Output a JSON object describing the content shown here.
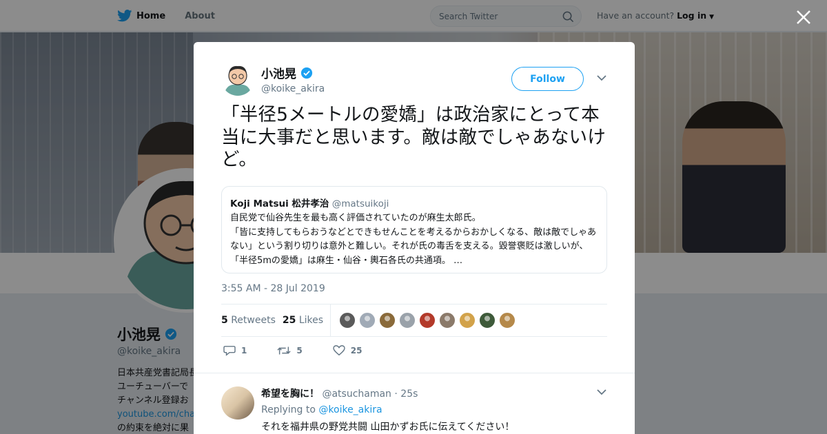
{
  "nav": {
    "home_label": "Home",
    "about_label": "About",
    "search_placeholder": "Search Twitter",
    "account_prompt": "Have an account?",
    "login_label": "Log in"
  },
  "profile": {
    "name": "小池晃",
    "handle": "@koike_akira",
    "bio_lines": [
      "日本共産党書記局長",
      "ユーチューバーで",
      "チャンネル登録お",
      "youtube.com/channel",
      "の約束を絶対に果"
    ]
  },
  "tweet": {
    "author_name": "小池晃",
    "author_handle": "@koike_akira",
    "follow_label": "Follow",
    "text": "「半径5メートルの愛嬌」は政治家にとって本当に大事だと思います。敵は敵でしゃあないけど。",
    "quote": {
      "name": "Koji Matsui 松井孝治",
      "handle": "@matsuikoji",
      "text": "自民党で仙谷先生を最も高く評価されていたのが麻生太郎氏。\n「皆に支持してもらおうなどとできもせんことを考えるからおかしくなる、敵は敵でしゃあない」という割り切りは意外と難しい。それが氏の毒舌を支える。毀誉褒貶は激しいが、「半径5mの愛嬌」は麻生・仙谷・輿石各氏の共通項。 …"
    },
    "timestamp": "3:55 AM - 28 Jul 2019",
    "retweets_count": "5",
    "retweets_label": "Retweets",
    "likes_count": "25",
    "likes_label": "Likes",
    "actions": {
      "reply_count": "1",
      "retweet_count": "5",
      "like_count": "25"
    },
    "likers_colors": [
      "#5a5a5a",
      "#a0aab6",
      "#8a6a3a",
      "#9aa2aa",
      "#b33a2a",
      "#8b7a6a",
      "#d2a24a",
      "#3e5a3a",
      "#b5894a"
    ]
  },
  "reply": {
    "name": "希望を胸に！",
    "handle": "@atsuchaman",
    "time": "· 25s",
    "replying_prefix": "Replying to",
    "replying_to": "@koike_akira",
    "text": "それを福井県の野党共闘 山田かずお氏に伝えてください！"
  },
  "colors": {
    "accent": "#1da1f2",
    "verified": "#1da1f2",
    "overlay": "rgba(0,0,0,0.45)"
  }
}
